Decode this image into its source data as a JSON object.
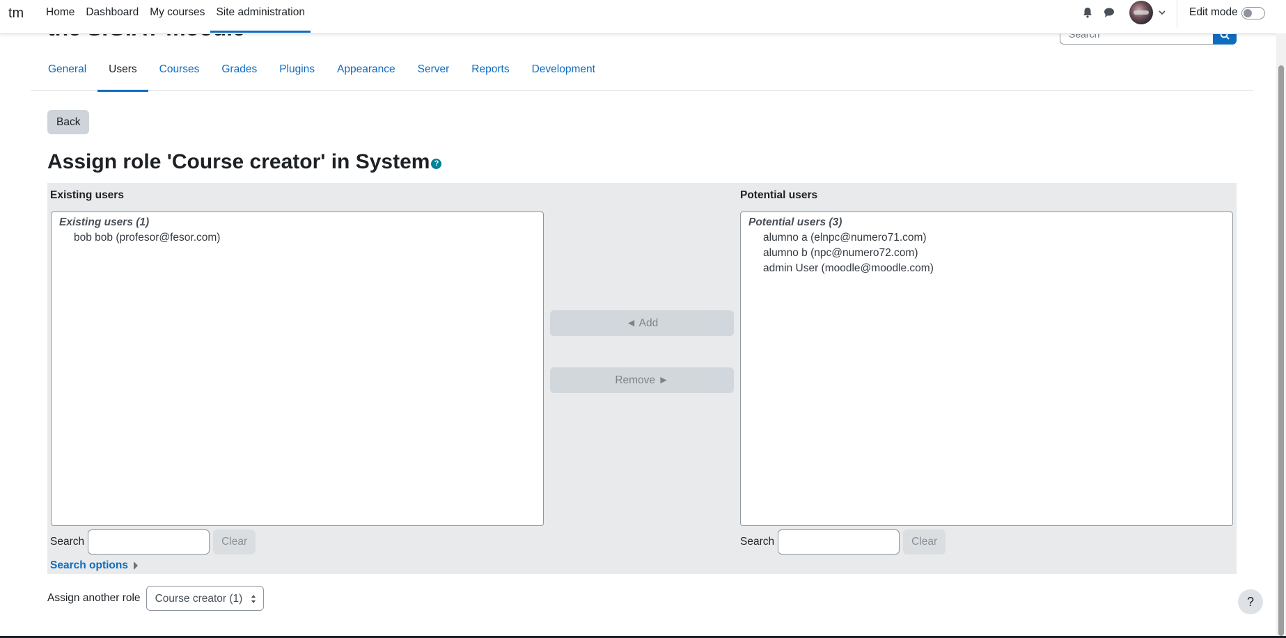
{
  "navbar": {
    "brand": "tm",
    "items": [
      {
        "label": "Home"
      },
      {
        "label": "Dashboard"
      },
      {
        "label": "My courses"
      },
      {
        "label": "Site administration"
      }
    ],
    "edit_mode_label": "Edit mode",
    "edit_mode_on": false
  },
  "header": {
    "site_name_partial": "the SIGIAT moodle",
    "search_placeholder": "Search"
  },
  "secondary_nav": {
    "tabs": [
      {
        "label": "General"
      },
      {
        "label": "Users"
      },
      {
        "label": "Courses"
      },
      {
        "label": "Grades"
      },
      {
        "label": "Plugins"
      },
      {
        "label": "Appearance"
      },
      {
        "label": "Server"
      },
      {
        "label": "Reports"
      },
      {
        "label": "Development"
      }
    ],
    "active": "Users"
  },
  "back_label": "Back",
  "page_title": "Assign role 'Course creator' in System",
  "existing": {
    "title": "Existing users",
    "group_label": "Existing users (1)",
    "users": [
      "bob bob (profesor@fesor.com)"
    ],
    "search_label": "Search",
    "clear_label": "Clear"
  },
  "potential": {
    "title": "Potential users",
    "group_label": "Potential users (3)",
    "users": [
      "alumno a (elnpc@numero71.com)",
      "alumno b (npc@numero72.com)",
      "admin User (moodle@moodle.com)"
    ],
    "search_label": "Search",
    "clear_label": "Clear"
  },
  "add_label": "◄ Add",
  "remove_label": "Remove ►",
  "search_options_label": "Search options",
  "assign_another": {
    "label": "Assign another role",
    "selected": "Course creator (1)"
  },
  "help_label": "?",
  "colors": {
    "link": "#0f6cbf",
    "panel_bg": "#e9eaeb",
    "help_badge": "#008196"
  }
}
